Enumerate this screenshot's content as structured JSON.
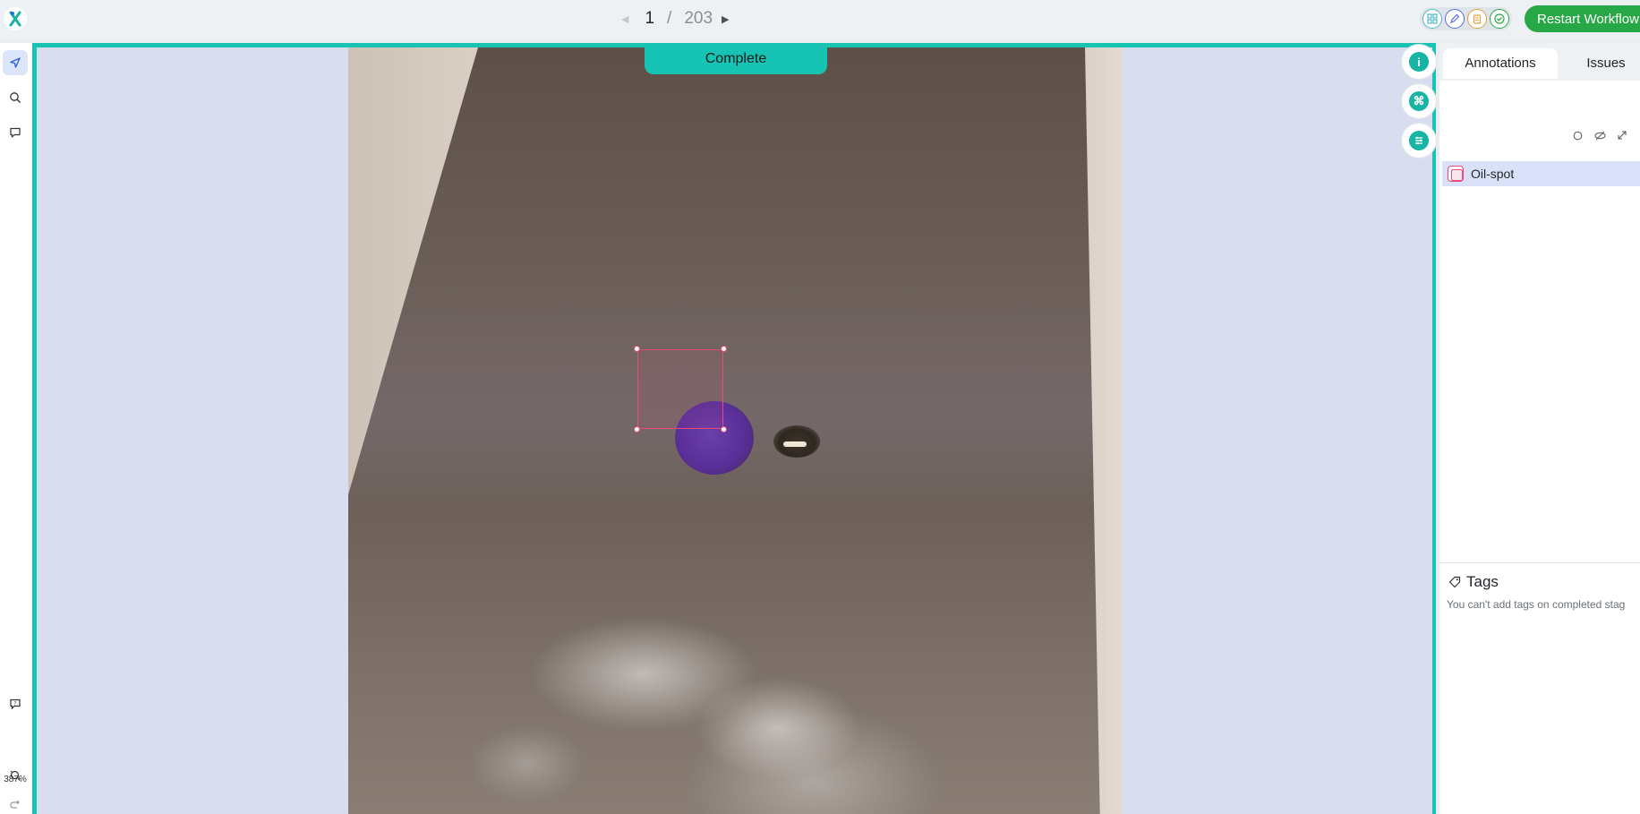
{
  "pager": {
    "current": "1",
    "separator": "/",
    "total": "203"
  },
  "stage_icons": [
    "grid-icon",
    "pencil-icon",
    "clipboard-icon",
    "check-icon"
  ],
  "workflow": {
    "restart_label": "Restart Workflow"
  },
  "left_toolbar": {
    "tools": [
      "pointer-icon",
      "search-icon",
      "comment-icon"
    ],
    "bottom_tools": [
      "help-icon",
      "zoom-fit-icon",
      "redo-icon"
    ],
    "zoom": "387%"
  },
  "canvas": {
    "status_label": "Complete"
  },
  "side_buttons": [
    "info-icon",
    "shortcuts-icon",
    "filter-icon"
  ],
  "panel": {
    "tabs": [
      {
        "label": "Annotations"
      },
      {
        "label": "Issues"
      }
    ],
    "annotations": [
      {
        "label": "Oil-spot"
      }
    ],
    "tags": {
      "title": "Tags",
      "note": "You can't add tags on completed stag"
    }
  },
  "colors": {
    "accent": "#17c3b2",
    "restart": "#27a745",
    "annotation": "#e94a7a"
  }
}
